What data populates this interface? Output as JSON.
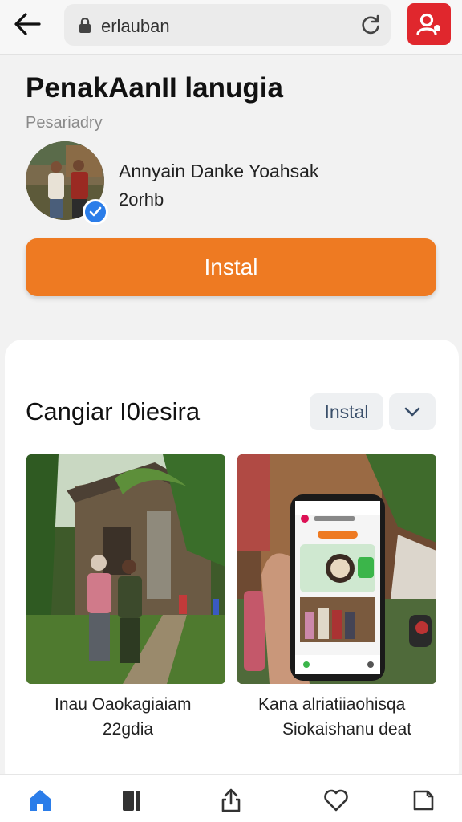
{
  "browser": {
    "url": "erlauban"
  },
  "app": {
    "title": "PenakAanII lanugia",
    "subtitle": "Pesariadry",
    "developer_name": "Annyain Danke Yoahsak",
    "developer_meta": "2orhb",
    "install_label": "Instal"
  },
  "section": {
    "title": "Cangiar I0iesira",
    "install_label": "Instal",
    "screenshots": [
      {
        "caption_line1": "Inau Oaokagiaiam",
        "caption_line2": "22gdia"
      },
      {
        "caption_line1": "Kana alriatiiaohisqa",
        "caption_line2": "Siokaishanu deat"
      }
    ]
  },
  "colors": {
    "accent": "#ee7a22",
    "profile": "#e0272d",
    "nav_active": "#2b7de9",
    "verified": "#2b7de9"
  },
  "icons": {
    "back": "back-arrow-icon",
    "lock": "lock-icon",
    "reload": "reload-icon",
    "profile": "profile-icon",
    "verified": "verified-check-icon",
    "chevron": "chevron-down-icon",
    "nav": [
      "home-icon",
      "library-icon",
      "share-icon",
      "heart-icon",
      "tabs-icon"
    ]
  }
}
